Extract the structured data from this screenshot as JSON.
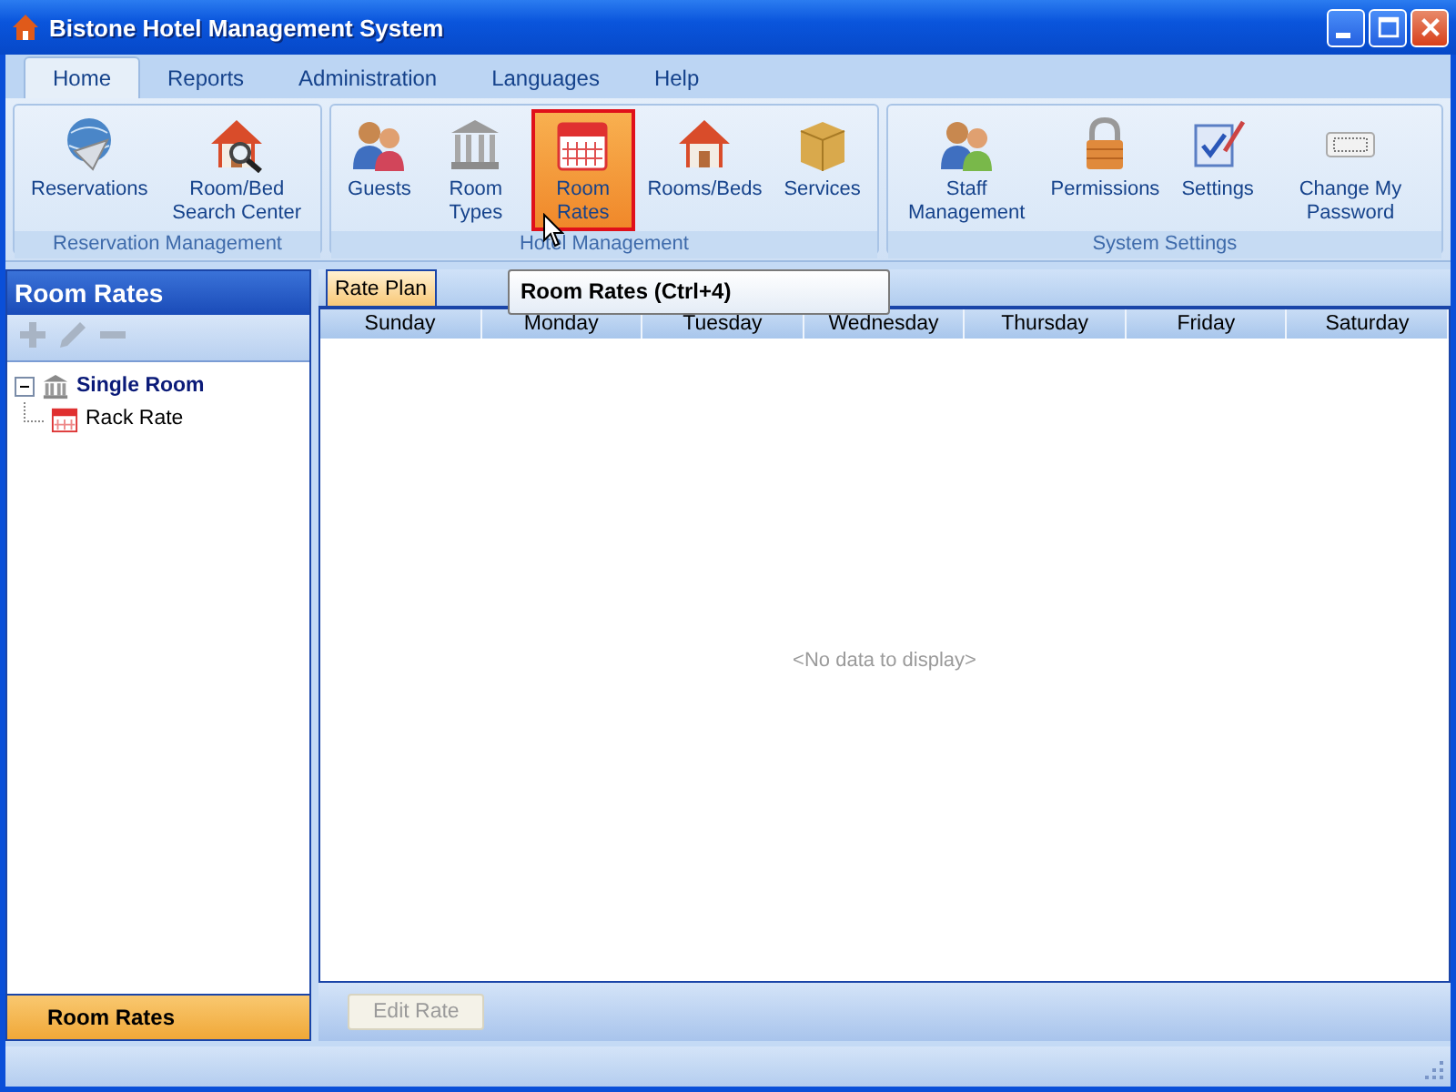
{
  "window": {
    "title": "Bistone Hotel Management System"
  },
  "ribbon": {
    "tabs": [
      {
        "label": "Home",
        "selected": true
      },
      {
        "label": "Reports",
        "selected": false
      },
      {
        "label": "Administration",
        "selected": false
      },
      {
        "label": "Languages",
        "selected": false
      },
      {
        "label": "Help",
        "selected": false
      }
    ],
    "groups": [
      {
        "label": "Reservation Management",
        "buttons": [
          {
            "label": "Reservations",
            "kind": "globe",
            "selected": false
          },
          {
            "label": "Room/Bed Search Center",
            "kind": "house-search",
            "selected": false
          }
        ]
      },
      {
        "label": "Hotel Management",
        "buttons": [
          {
            "label": "Guests",
            "kind": "people",
            "selected": false
          },
          {
            "label": "Room Types",
            "kind": "building",
            "selected": false
          },
          {
            "label": "Room Rates",
            "kind": "calendar",
            "selected": true
          },
          {
            "label": "Rooms/Beds",
            "kind": "house",
            "selected": false
          },
          {
            "label": "Services",
            "kind": "box",
            "selected": false
          }
        ]
      },
      {
        "label": "System Settings",
        "buttons": [
          {
            "label": "Staff Management",
            "kind": "group",
            "selected": false
          },
          {
            "label": "Permissions",
            "kind": "lock",
            "selected": false
          },
          {
            "label": "Settings",
            "kind": "checklist",
            "selected": false
          },
          {
            "label": "Change My Password",
            "kind": "password",
            "selected": false
          }
        ]
      }
    ]
  },
  "tooltip": "Room Rates (Ctrl+4)",
  "left_panel": {
    "title": "Room Rates",
    "toolbar": [
      {
        "kind": "add",
        "disabled": true
      },
      {
        "kind": "edit",
        "disabled": true
      },
      {
        "kind": "remove",
        "disabled": true
      }
    ],
    "tree": [
      {
        "label": "Single Room",
        "kind": "building",
        "expanded": true,
        "children": [
          {
            "label": "Rack Rate",
            "kind": "calendar"
          }
        ]
      }
    ],
    "nav_button": "Room Rates"
  },
  "content": {
    "tabs": [
      {
        "label": "Rate Plan",
        "selected": true
      }
    ],
    "columns": [
      "Sunday",
      "Monday",
      "Tuesday",
      "Wednesday",
      "Thursday",
      "Friday",
      "Saturday"
    ],
    "empty_text": "<No data to display>",
    "buttons": [
      {
        "label": "Edit Rate",
        "disabled": true
      }
    ]
  }
}
